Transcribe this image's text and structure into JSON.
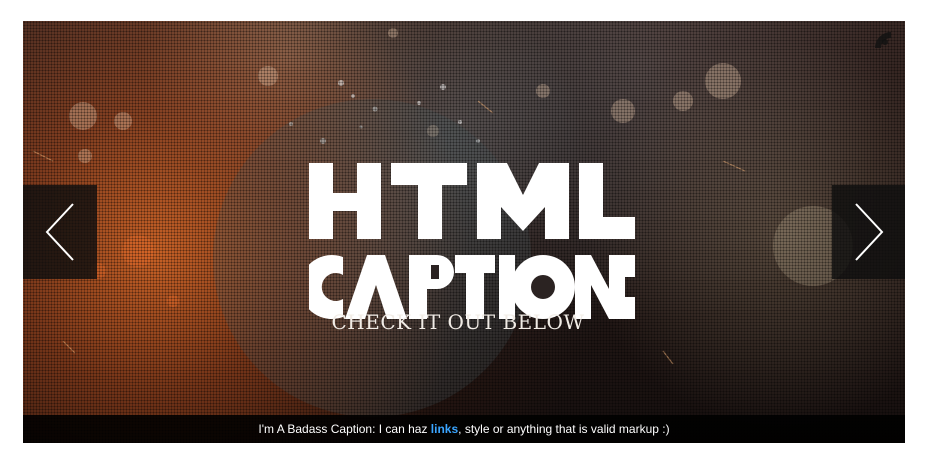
{
  "slide": {
    "headline_line1": "HTML",
    "headline_line2": "CAPTIONS",
    "subtitle": "CHECK IT OUT BELOW"
  },
  "navigation": {
    "prev_icon": "chevron-left-icon",
    "next_icon": "chevron-right-icon"
  },
  "caption": {
    "prefix": "I'm A Badass Caption: I can haz ",
    "link_text": "links",
    "suffix": ", style or anything that is valid markup :)"
  },
  "colors": {
    "link": "#3aa5ff",
    "caption_bg": "#000000",
    "nav_bg": "#0f0f0f"
  }
}
